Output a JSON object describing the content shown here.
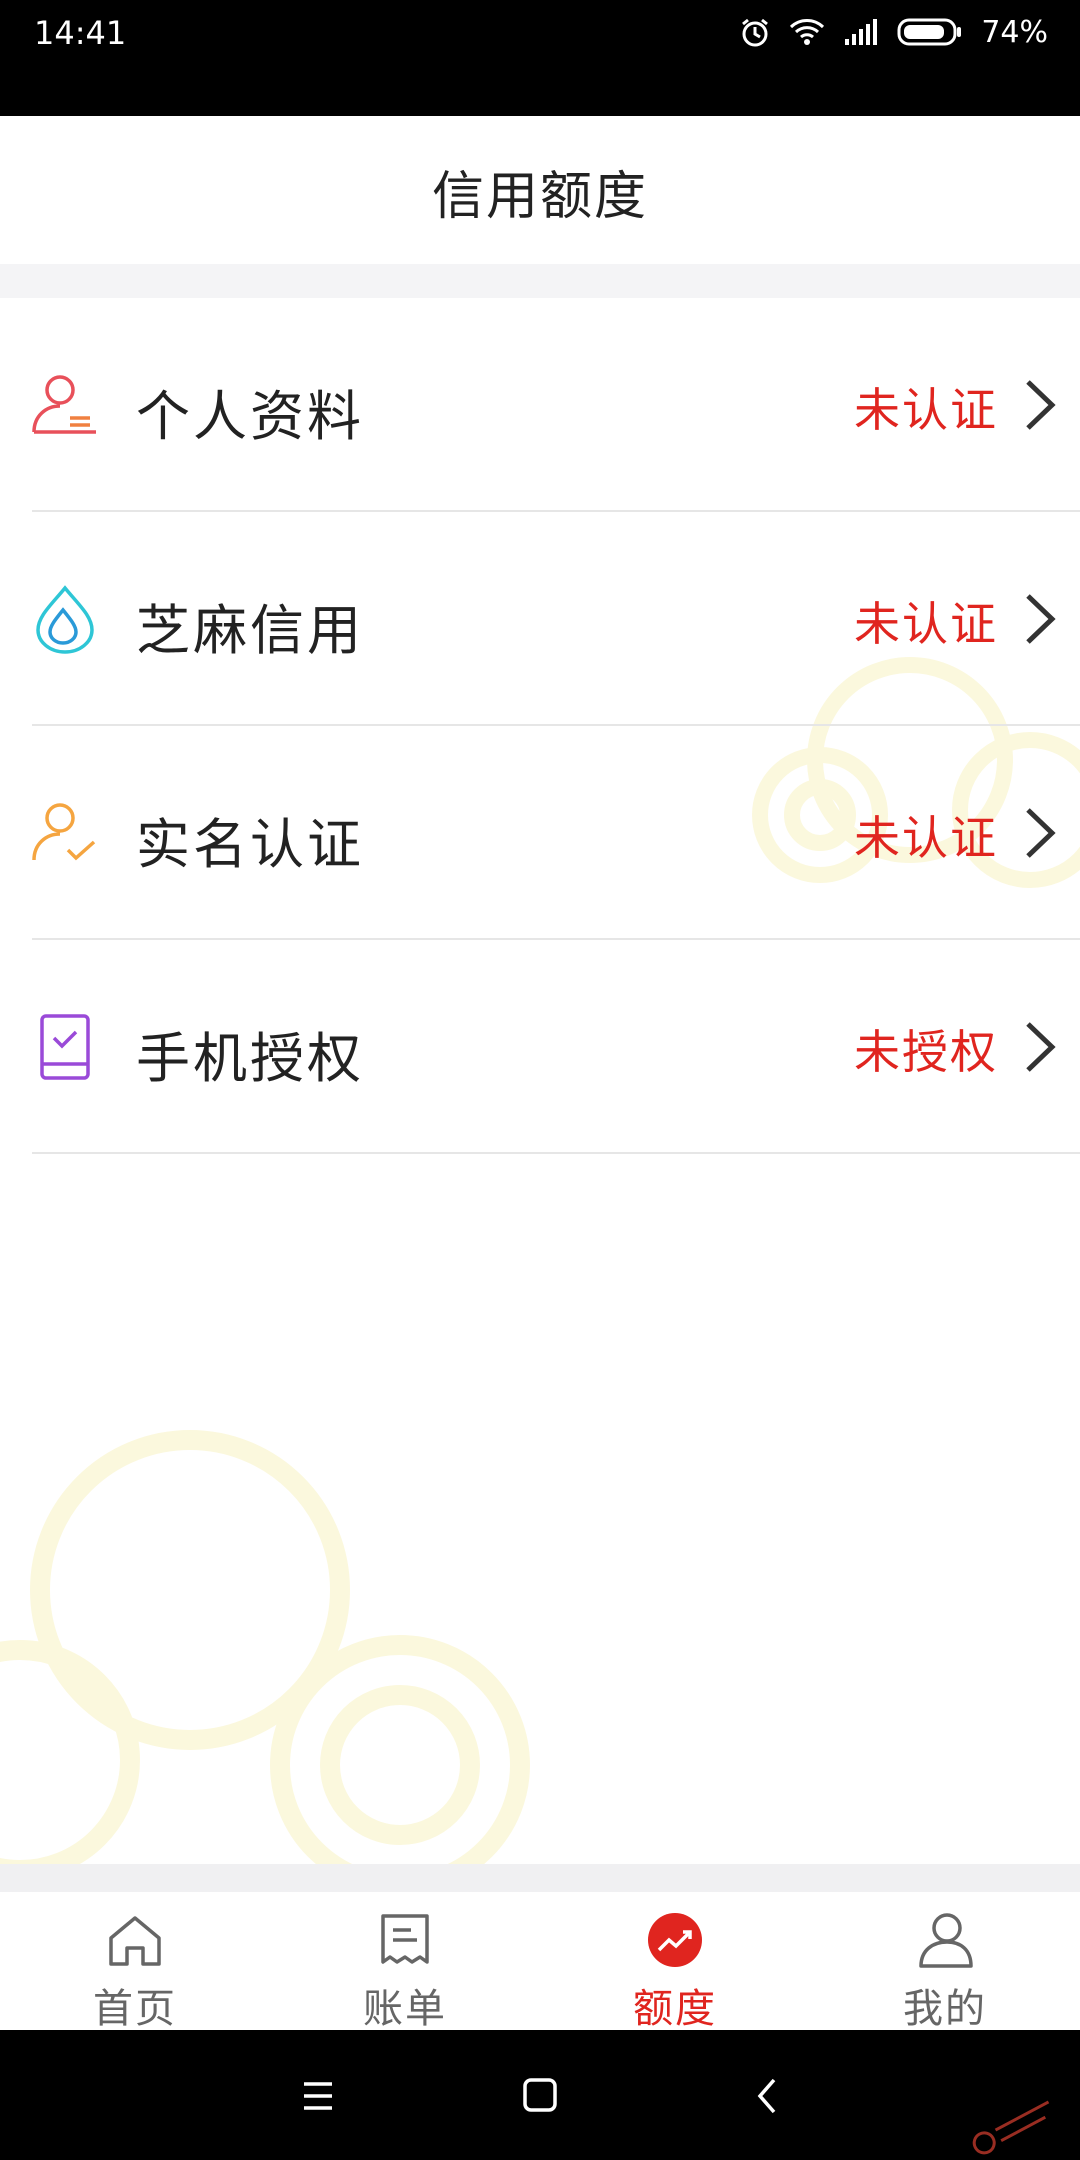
{
  "status_bar": {
    "time": "14:41",
    "battery": "74%"
  },
  "header": {
    "title": "信用额度"
  },
  "list": [
    {
      "label": "个人资料",
      "status": "未认证",
      "icon": "person-doc-icon",
      "color": "#e8505a"
    },
    {
      "label": "芝麻信用",
      "status": "未认证",
      "icon": "sesame-drop-icon",
      "color": "#2ec6d6"
    },
    {
      "label": "实名认证",
      "status": "未认证",
      "icon": "person-check-icon",
      "color": "#f5a540"
    },
    {
      "label": "手机授权",
      "status": "未授权",
      "icon": "phone-book-icon",
      "color": "#9a4ad8"
    }
  ],
  "tabs": [
    {
      "label": "首页",
      "icon": "home-icon",
      "active": false
    },
    {
      "label": "账单",
      "icon": "bill-icon",
      "active": false
    },
    {
      "label": "额度",
      "icon": "credit-trend-icon",
      "active": true
    },
    {
      "label": "我的",
      "icon": "profile-icon",
      "active": false
    }
  ],
  "colors": {
    "accent": "#e0251f",
    "text": "#222222",
    "muted": "#666666"
  }
}
